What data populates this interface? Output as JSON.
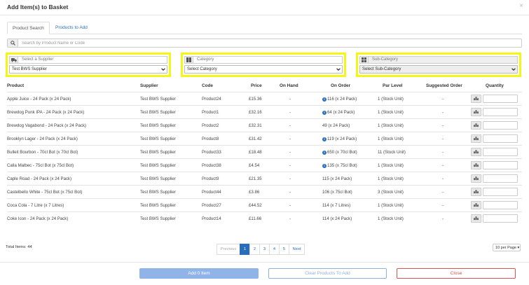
{
  "modal": {
    "title": "Add Item(s) to Basket",
    "close_glyph": "×"
  },
  "tabs": [
    {
      "label": "Product Search",
      "active": true
    },
    {
      "label": "Products to Add",
      "active": false
    }
  ],
  "search": {
    "placeholder": "Search by Product Name or Code",
    "value": ""
  },
  "filters": {
    "supplier": {
      "label": "Select a Supplier",
      "value": "Test BWS Supplier",
      "icon": "truck-icon"
    },
    "category": {
      "label": "Category",
      "value": "Select Category",
      "icon": "grid-icon"
    },
    "subcategory": {
      "label": "Sub-Category",
      "value": "Select Sub-Category",
      "icon": "grid-icon",
      "disabled": true
    }
  },
  "table": {
    "headers": {
      "product": "Product",
      "supplier": "Supplier",
      "code": "Code",
      "price": "Price",
      "on_hand": "On Hand",
      "on_order": "On Order",
      "par_level": "Par Level",
      "suggested": "Suggested Order",
      "quantity": "Quantity"
    },
    "rows": [
      {
        "product": "Apple Juice - 24 Pack (x 24 Pack)",
        "supplier": "Test BWS Supplier",
        "code": "Product24",
        "price": "£15.36",
        "on_hand": "-",
        "on_order": "116 (x 24 Pack)",
        "info": true,
        "par_level": "1 (Stock Unit)",
        "suggested": "-"
      },
      {
        "product": "Brewdog Punk IPA - 24 Pack (x 24 Pack)",
        "supplier": "Test BWS Supplier",
        "code": "Product1",
        "price": "£32.16",
        "on_hand": "-",
        "on_order": "64 (x 24 Pack)",
        "info": true,
        "par_level": "1 (Stock Unit)",
        "suggested": "-"
      },
      {
        "product": "Brewdog Vagabond - 24 Pack (x 24 Pack)",
        "supplier": "Test BWS Supplier",
        "code": "Product2",
        "price": "£32.31",
        "on_hand": "-",
        "on_order": "49 (x 24 Pack)",
        "info": false,
        "par_level": "1 (Stock Unit)",
        "suggested": "-"
      },
      {
        "product": "Brooklyn Lager - 24 Pack (x 24 Pack)",
        "supplier": "Test BWS Supplier",
        "code": "Product8",
        "price": "£31.42",
        "on_hand": "-",
        "on_order": "119 (x 24 Pack)",
        "info": true,
        "par_level": "1 (Stock Unit)",
        "suggested": "-"
      },
      {
        "product": "Bulleit Bourbon - 70cl Bot (x 70cl Bot)",
        "supplier": "Test BWS Supplier",
        "code": "Product33",
        "price": "£18.48",
        "on_hand": "-",
        "on_order": "650 (x 70cl Bot)",
        "info": true,
        "par_level": "11 (Stock Unit)",
        "suggested": "-"
      },
      {
        "product": "Calla Malbec - 75cl Bot (x 75cl Bot)",
        "supplier": "Test BWS Supplier",
        "code": "Product38",
        "price": "£4.54",
        "on_hand": "-",
        "on_order": "135 (x 75cl Bot)",
        "info": true,
        "par_level": "1 (Stock Unit)",
        "suggested": "-"
      },
      {
        "product": "Caple Road - 24 Pack (x 24 Pack)",
        "supplier": "Test BWS Supplier",
        "code": "Product9",
        "price": "£21.35",
        "on_hand": "-",
        "on_order": "115 (x 24 Pack)",
        "info": false,
        "par_level": "1 (Stock Unit)",
        "suggested": "-"
      },
      {
        "product": "Castelbello White - 75cl Bot (x 75cl Bot)",
        "supplier": "Test BWS Supplier",
        "code": "Product44",
        "price": "£3.86",
        "on_hand": "-",
        "on_order": "106 (x 75cl Bot)",
        "info": false,
        "par_level": "3 (Stock Unit)",
        "suggested": "-"
      },
      {
        "product": "Coca Cola - 7 Litre (x 7 Litres)",
        "supplier": "Test BWS Supplier",
        "code": "Product27",
        "price": "£44.52",
        "on_hand": "-",
        "on_order": "114 (x 7 Litres)",
        "info": false,
        "par_level": "1 (Stock Unit)",
        "suggested": "-"
      },
      {
        "product": "Coke Icon - 24 Pack (x 24 Pack)",
        "supplier": "Test BWS Supplier",
        "code": "Product14",
        "price": "£11.66",
        "on_hand": "-",
        "on_order": "114 (x 24 Pack)",
        "info": false,
        "par_level": "1 (Stock Unit)",
        "suggested": "-"
      }
    ]
  },
  "total_label": "Total Items: 44",
  "pagination": {
    "previous": "Previous",
    "pages": [
      "1",
      "2",
      "3",
      "4",
      "5"
    ],
    "active_page": "1",
    "next": "Next"
  },
  "per_page": "10 per Page ▾",
  "footer": {
    "add": "Add 0 Item",
    "clear": "Clear Products To Add",
    "close": "Close"
  },
  "colors": {
    "primary": "#2a6ebb",
    "highlight": "#f5f516",
    "danger": "#d9534f"
  }
}
